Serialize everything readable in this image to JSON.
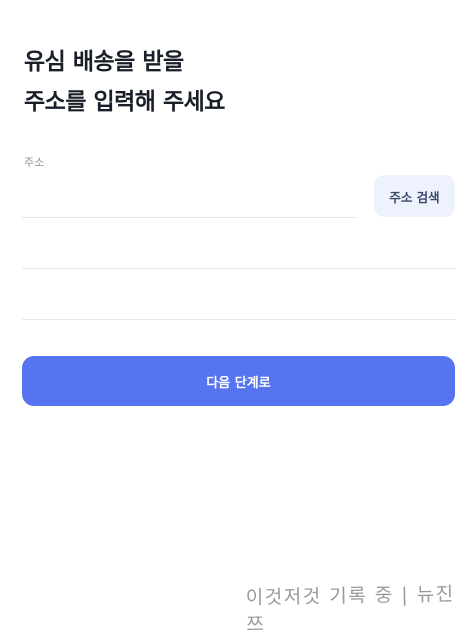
{
  "heading": {
    "line1": "유심 배송을 받을",
    "line2": "주소를 입력해 주세요"
  },
  "address": {
    "label": "주소",
    "value": "",
    "search_button": "주소 검색"
  },
  "detail_fields": [
    {
      "value": ""
    },
    {
      "value": ""
    }
  ],
  "next_button": "다음 단계로",
  "watermark": "이것저것 기록 중 | 뉴진쯔",
  "colors": {
    "primary": "#5673f0",
    "search_button_bg": "#eef2fd",
    "divider": "#e5e8eb"
  }
}
